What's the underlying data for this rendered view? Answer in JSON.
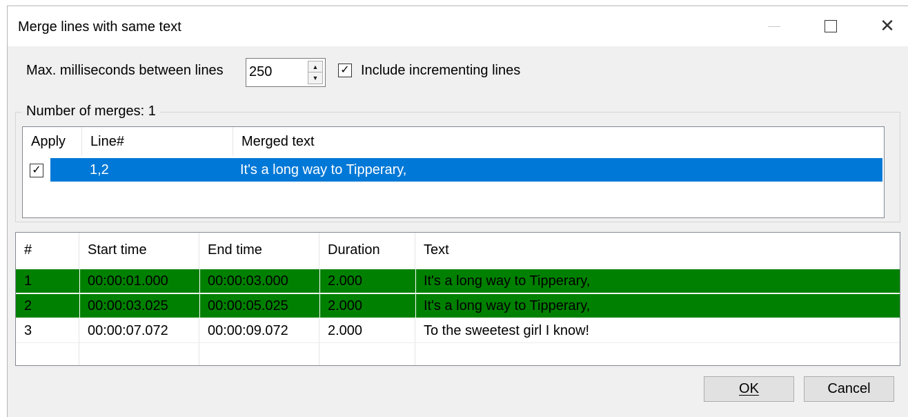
{
  "window": {
    "title": "Merge lines with same text",
    "close_glyph": "✕"
  },
  "options": {
    "max_ms_label": "Max. milliseconds between lines",
    "max_ms_value": "250",
    "include_incrementing_label": "Include incrementing lines",
    "include_incrementing_checked": true
  },
  "merges": {
    "group_title": "Number of merges: 1",
    "columns": [
      "Apply",
      "Line#",
      "Merged text"
    ],
    "rows": [
      {
        "apply": true,
        "line": "1,2",
        "text": "It's a long way to Tipperary,"
      }
    ]
  },
  "subtitles": {
    "columns": [
      "#",
      "Start time",
      "End time",
      "Duration",
      "Text"
    ],
    "rows": [
      {
        "num": "1",
        "start": "00:00:01.000",
        "end": "00:00:03.000",
        "duration": "2.000",
        "text": "It's a long way to Tipperary,",
        "highlight": true
      },
      {
        "num": "2",
        "start": "00:00:03.025",
        "end": "00:00:05.025",
        "duration": "2.000",
        "text": "It's a long way to Tipperary,",
        "highlight": true
      },
      {
        "num": "3",
        "start": "00:00:07.072",
        "end": "00:00:09.072",
        "duration": "2.000",
        "text": "To the sweetest girl I know!",
        "highlight": false
      }
    ]
  },
  "buttons": {
    "ok": "OK",
    "cancel": "Cancel"
  },
  "icons": {
    "checkmark": "✓",
    "spin_up": "▲",
    "spin_down": "▼"
  },
  "colors": {
    "selection": "#0078d7",
    "merge_highlight": "#008000",
    "dialog_bg": "#f0f0f0"
  }
}
